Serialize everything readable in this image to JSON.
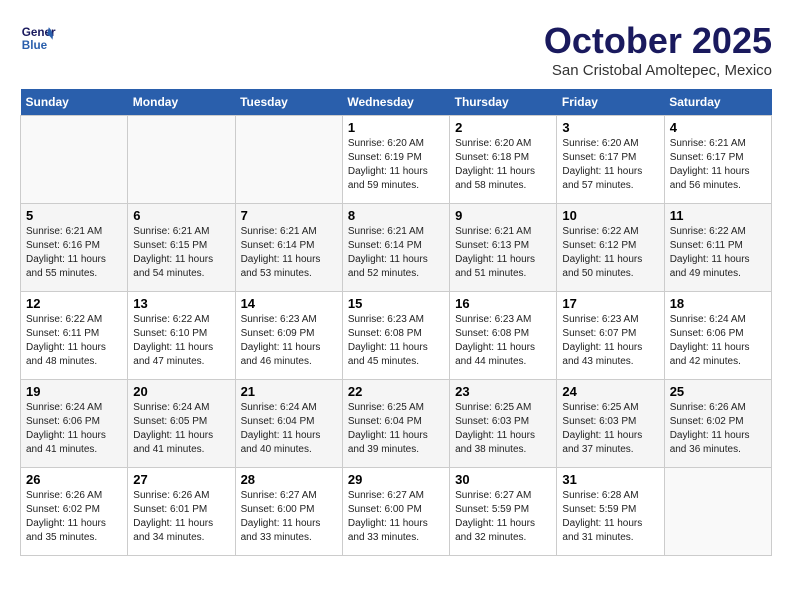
{
  "header": {
    "logo_line1": "General",
    "logo_line2": "Blue",
    "month": "October 2025",
    "location": "San Cristobal Amoltepec, Mexico"
  },
  "weekdays": [
    "Sunday",
    "Monday",
    "Tuesday",
    "Wednesday",
    "Thursday",
    "Friday",
    "Saturday"
  ],
  "weeks": [
    [
      {
        "day": "",
        "info": ""
      },
      {
        "day": "",
        "info": ""
      },
      {
        "day": "",
        "info": ""
      },
      {
        "day": "1",
        "info": "Sunrise: 6:20 AM\nSunset: 6:19 PM\nDaylight: 11 hours\nand 59 minutes."
      },
      {
        "day": "2",
        "info": "Sunrise: 6:20 AM\nSunset: 6:18 PM\nDaylight: 11 hours\nand 58 minutes."
      },
      {
        "day": "3",
        "info": "Sunrise: 6:20 AM\nSunset: 6:17 PM\nDaylight: 11 hours\nand 57 minutes."
      },
      {
        "day": "4",
        "info": "Sunrise: 6:21 AM\nSunset: 6:17 PM\nDaylight: 11 hours\nand 56 minutes."
      }
    ],
    [
      {
        "day": "5",
        "info": "Sunrise: 6:21 AM\nSunset: 6:16 PM\nDaylight: 11 hours\nand 55 minutes."
      },
      {
        "day": "6",
        "info": "Sunrise: 6:21 AM\nSunset: 6:15 PM\nDaylight: 11 hours\nand 54 minutes."
      },
      {
        "day": "7",
        "info": "Sunrise: 6:21 AM\nSunset: 6:14 PM\nDaylight: 11 hours\nand 53 minutes."
      },
      {
        "day": "8",
        "info": "Sunrise: 6:21 AM\nSunset: 6:14 PM\nDaylight: 11 hours\nand 52 minutes."
      },
      {
        "day": "9",
        "info": "Sunrise: 6:21 AM\nSunset: 6:13 PM\nDaylight: 11 hours\nand 51 minutes."
      },
      {
        "day": "10",
        "info": "Sunrise: 6:22 AM\nSunset: 6:12 PM\nDaylight: 11 hours\nand 50 minutes."
      },
      {
        "day": "11",
        "info": "Sunrise: 6:22 AM\nSunset: 6:11 PM\nDaylight: 11 hours\nand 49 minutes."
      }
    ],
    [
      {
        "day": "12",
        "info": "Sunrise: 6:22 AM\nSunset: 6:11 PM\nDaylight: 11 hours\nand 48 minutes."
      },
      {
        "day": "13",
        "info": "Sunrise: 6:22 AM\nSunset: 6:10 PM\nDaylight: 11 hours\nand 47 minutes."
      },
      {
        "day": "14",
        "info": "Sunrise: 6:23 AM\nSunset: 6:09 PM\nDaylight: 11 hours\nand 46 minutes."
      },
      {
        "day": "15",
        "info": "Sunrise: 6:23 AM\nSunset: 6:08 PM\nDaylight: 11 hours\nand 45 minutes."
      },
      {
        "day": "16",
        "info": "Sunrise: 6:23 AM\nSunset: 6:08 PM\nDaylight: 11 hours\nand 44 minutes."
      },
      {
        "day": "17",
        "info": "Sunrise: 6:23 AM\nSunset: 6:07 PM\nDaylight: 11 hours\nand 43 minutes."
      },
      {
        "day": "18",
        "info": "Sunrise: 6:24 AM\nSunset: 6:06 PM\nDaylight: 11 hours\nand 42 minutes."
      }
    ],
    [
      {
        "day": "19",
        "info": "Sunrise: 6:24 AM\nSunset: 6:06 PM\nDaylight: 11 hours\nand 41 minutes."
      },
      {
        "day": "20",
        "info": "Sunrise: 6:24 AM\nSunset: 6:05 PM\nDaylight: 11 hours\nand 41 minutes."
      },
      {
        "day": "21",
        "info": "Sunrise: 6:24 AM\nSunset: 6:04 PM\nDaylight: 11 hours\nand 40 minutes."
      },
      {
        "day": "22",
        "info": "Sunrise: 6:25 AM\nSunset: 6:04 PM\nDaylight: 11 hours\nand 39 minutes."
      },
      {
        "day": "23",
        "info": "Sunrise: 6:25 AM\nSunset: 6:03 PM\nDaylight: 11 hours\nand 38 minutes."
      },
      {
        "day": "24",
        "info": "Sunrise: 6:25 AM\nSunset: 6:03 PM\nDaylight: 11 hours\nand 37 minutes."
      },
      {
        "day": "25",
        "info": "Sunrise: 6:26 AM\nSunset: 6:02 PM\nDaylight: 11 hours\nand 36 minutes."
      }
    ],
    [
      {
        "day": "26",
        "info": "Sunrise: 6:26 AM\nSunset: 6:02 PM\nDaylight: 11 hours\nand 35 minutes."
      },
      {
        "day": "27",
        "info": "Sunrise: 6:26 AM\nSunset: 6:01 PM\nDaylight: 11 hours\nand 34 minutes."
      },
      {
        "day": "28",
        "info": "Sunrise: 6:27 AM\nSunset: 6:00 PM\nDaylight: 11 hours\nand 33 minutes."
      },
      {
        "day": "29",
        "info": "Sunrise: 6:27 AM\nSunset: 6:00 PM\nDaylight: 11 hours\nand 33 minutes."
      },
      {
        "day": "30",
        "info": "Sunrise: 6:27 AM\nSunset: 5:59 PM\nDaylight: 11 hours\nand 32 minutes."
      },
      {
        "day": "31",
        "info": "Sunrise: 6:28 AM\nSunset: 5:59 PM\nDaylight: 11 hours\nand 31 minutes."
      },
      {
        "day": "",
        "info": ""
      }
    ]
  ]
}
